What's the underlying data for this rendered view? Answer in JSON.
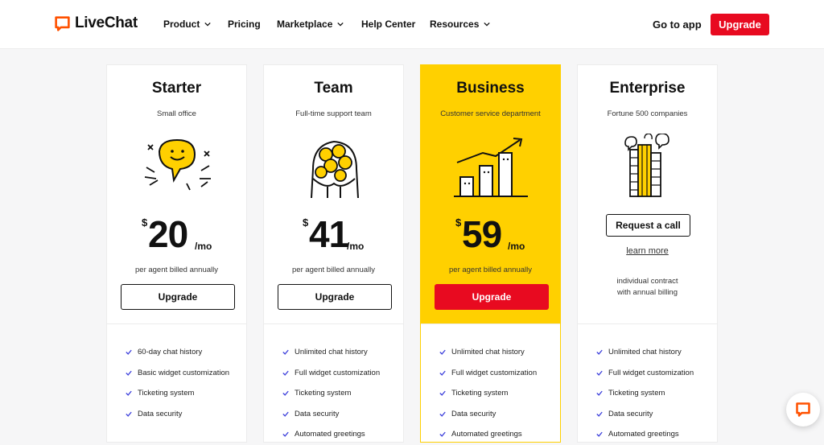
{
  "nav": {
    "brand": "LiveChat",
    "items": [
      {
        "label": "Product",
        "dropdown": true
      },
      {
        "label": "Pricing",
        "dropdown": false
      },
      {
        "label": "Marketplace",
        "dropdown": true
      },
      {
        "label": "Help Center",
        "dropdown": false
      },
      {
        "label": "Resources",
        "dropdown": true
      }
    ],
    "go_to_app": "Go to app",
    "upgrade": "Upgrade"
  },
  "colors": {
    "brand_red": "#e80a20",
    "highlight_yellow": "#ffd000",
    "check_blue": "#3a3ddb"
  },
  "plans": [
    {
      "name": "Starter",
      "subtitle": "Small office",
      "currency": "$",
      "price": "20",
      "period": "/mo",
      "billing": "per agent billed annually",
      "cta": "Upgrade",
      "features": [
        "60-day chat history",
        "Basic widget customization",
        "Ticketing system",
        "Data security"
      ]
    },
    {
      "name": "Team",
      "subtitle": "Full-time support team",
      "currency": "$",
      "price": "41",
      "period": "/mo",
      "billing": "per agent billed annually",
      "cta": "Upgrade",
      "features": [
        "Unlimited chat history",
        "Full widget customization",
        "Ticketing system",
        "Data security",
        "Automated greetings"
      ]
    },
    {
      "name": "Business",
      "subtitle": "Customer service department",
      "currency": "$",
      "price": "59",
      "period": "/mo",
      "billing": "per agent billed annually",
      "cta": "Upgrade",
      "features": [
        "Unlimited chat history",
        "Full widget customization",
        "Ticketing system",
        "Data security",
        "Automated greetings"
      ]
    },
    {
      "name": "Enterprise",
      "subtitle": "Fortune 500 companies",
      "cta": "Request a call",
      "learn_more": "learn more",
      "contract_line1": "individual contract",
      "contract_line2": "with annual billing",
      "features": [
        "Unlimited chat history",
        "Full widget customization",
        "Ticketing system",
        "Data security",
        "Automated greetings"
      ]
    }
  ],
  "icons": {
    "logo": "livechat-bubble-icon",
    "chat_widget": "chat-bubble-icon"
  }
}
